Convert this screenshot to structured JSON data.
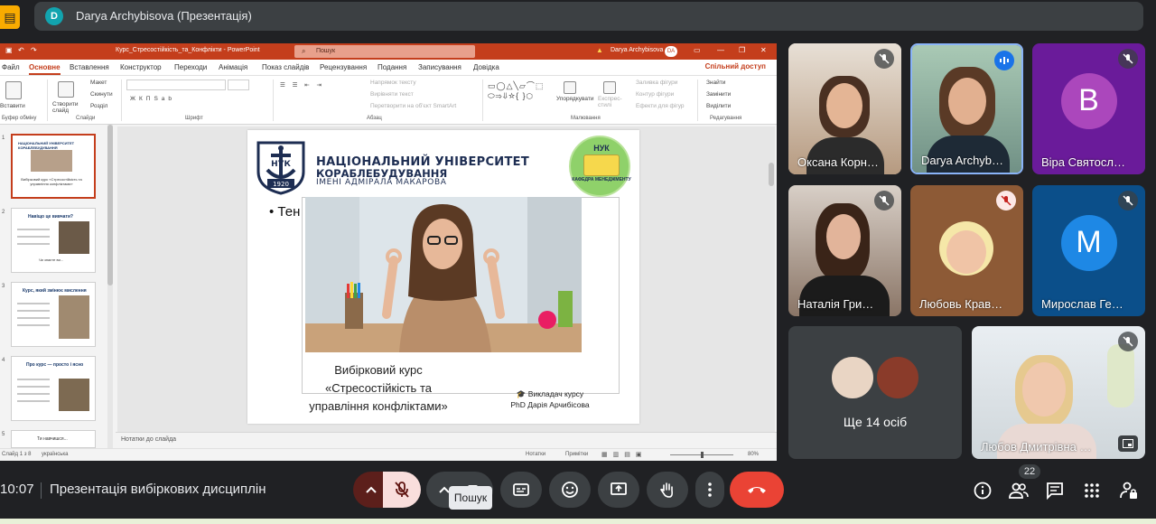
{
  "meeting": {
    "presenter_initial": "D",
    "presenter_label": "Darya Archybisova (Презентація)",
    "time": "10:07",
    "title": "Презентація вибіркових дисциплін",
    "participant_count": "22",
    "tooltip": "Пошук"
  },
  "ppt": {
    "window_title": "Курс_Стресостійкість_та_Конфлікти  -  PowerPoint",
    "search_placeholder": "Пошук",
    "user_name": "Darya Archybisova",
    "user_badge": "DA",
    "share_label": "Спільний доступ",
    "menu": [
      "Файл",
      "Основне",
      "Вставлення",
      "Конструктор",
      "Переходи",
      "Анімація",
      "Показ слайдів",
      "Рецензування",
      "Подання",
      "Записування",
      "Довідка"
    ],
    "active_menu": "Основне",
    "ribbon": {
      "paste": "Вставити",
      "create_slide": "Створити слайд",
      "layout": "Макет",
      "reset": "Скинути",
      "section": "Розділ",
      "text_direction": "Напрямок тексту",
      "align_text": "Вирівняти текст",
      "smartart": "Перетворити на об'єкт SmartArt",
      "arrange": "Упорядкувати",
      "quick_styles": "Експрес-стилі",
      "shape_fill": "Заливка фігури",
      "shape_outline": "Контур фігури",
      "shape_effects": "Ефекти для фігур",
      "find": "Знайти",
      "replace": "Замінити",
      "select": "Виділити",
      "groups": [
        "Буфер обміну",
        "Слайди",
        "Шрифт",
        "Абзац",
        "Малювання",
        "Редагування"
      ]
    },
    "thumbs": [
      {
        "num": "1",
        "title": "НАЦІОНАЛЬНИЙ УНІВЕРСИТЕТ КОРАБЛЕБУДУВАННЯ",
        "text": "Вибірковий курс «Стресостійкість та управління конфліктами»"
      },
      {
        "num": "2",
        "title": "Навіщо це вивчати?",
        "text": "Чи знаєте ви..."
      },
      {
        "num": "3",
        "title": "Курс, який змінює мислення",
        "text": ""
      },
      {
        "num": "4",
        "title": "Про курс — просто і ясно",
        "text": ""
      },
      {
        "num": "5",
        "title": "Ти навчишся...",
        "text": ""
      }
    ],
    "notes_label": "Нотатки до слайда",
    "status_slide": "Слайд 1 з 8",
    "status_lang": "українська",
    "status_notes": "Нотатки",
    "status_comments": "Примітки",
    "zoom": "80%"
  },
  "slide": {
    "uni_line1": "НАЦІОНАЛЬНИЙ УНІВЕРСИТЕТ",
    "uni_line2": "КОРАБЛЕБУДУВАННЯ",
    "uni_line3": "ІМЕНІ АДМІРАЛА МАКАРОВА",
    "logo_text": "НУК",
    "logo_year": "1920",
    "badge_top": "НУК",
    "badge_bottom": "КАФЕДРА МЕНЕДЖМЕНТУ",
    "bullet": "• Тен",
    "course_line1": "Вибірковий курс",
    "course_line2": "«Стресостійкість та",
    "course_line3": "управління конфліктами»",
    "teacher_line1": "Викладач курсу",
    "teacher_line2": "PhD Дарія Арчибісова"
  },
  "participants": [
    {
      "name": "Оксана Корн…",
      "muted": true
    },
    {
      "name": "Darya Archyb…",
      "muted": false,
      "speaking": true
    },
    {
      "name": "Віра Святосл…",
      "initial": "В",
      "color": "#9c27b0",
      "muted": true
    },
    {
      "name": "Наталія Гри…",
      "muted": true
    },
    {
      "name": "Любовь Крав…",
      "muted": true
    },
    {
      "name": "Мирослав Ге…",
      "initial": "М",
      "color": "#1e88e5",
      "muted": true
    },
    {
      "name": "Ще 14 осіб"
    },
    {
      "name": "Любов Дмитрівна …",
      "muted": true
    }
  ],
  "colors": {
    "meet_bg": "#202124",
    "ppt_accent": "#c43e1c",
    "end_call": "#ea4335",
    "mic_off": "#f9dedc"
  }
}
